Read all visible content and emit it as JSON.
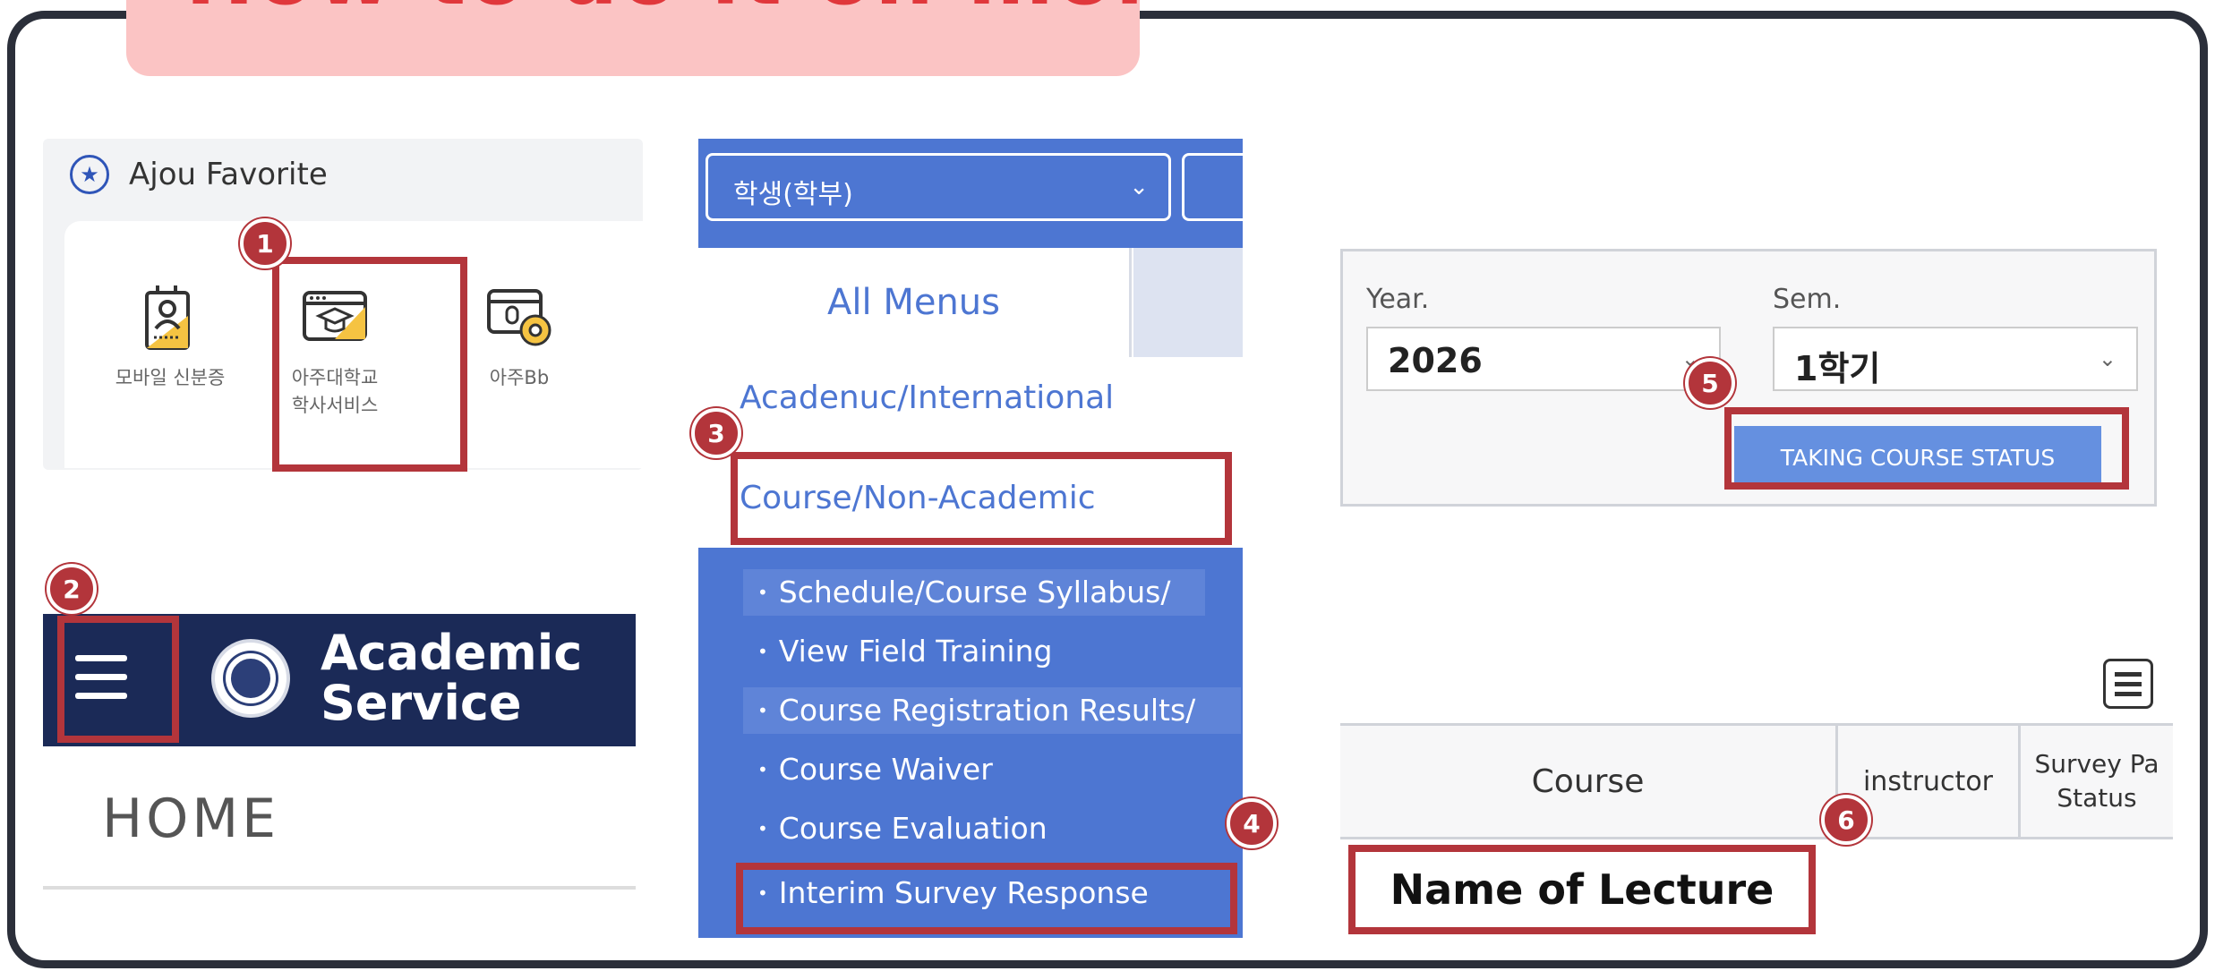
{
  "page": {
    "title": "How to do it on mobile"
  },
  "favorites": {
    "title": "Ajou Favorite",
    "items": [
      {
        "label_l1": "모바일 신분증",
        "label_l2": "",
        "icon": "id-badge-icon"
      },
      {
        "label_l1": "아주대학교",
        "label_l2": "학사서비스",
        "icon": "graduation-cap-window-icon"
      },
      {
        "label_l1": "아주Bb",
        "label_l2": "",
        "icon": "mic-settings-icon"
      }
    ]
  },
  "academic_service": {
    "title_l1": "Academic",
    "title_l2": "Service",
    "home": "HOME"
  },
  "menu": {
    "select_value": "학생(학부)",
    "all_menus": "All Menus",
    "items": [
      "Acadenuc/International",
      "Course/Non-Academic"
    ],
    "sub_items": [
      "Schedule/Course Syllabus/",
      "View Field Training",
      "Course Registration Results/",
      "Course Waiver",
      "Course Evaluation",
      "Interim Survey Response"
    ]
  },
  "filters": {
    "year_label": "Year.",
    "year_value": "2026",
    "sem_label": "Sem.",
    "sem_value": "1학기",
    "button": "TAKING COURSE STATUS"
  },
  "table": {
    "headers": [
      "Course",
      "instructor",
      "Survey Pa",
      "Status"
    ],
    "row_value": "Name of Lecture"
  },
  "steps": [
    "1",
    "2",
    "3",
    "4",
    "5",
    "6"
  ],
  "colors": {
    "accent_red": "#b3353b",
    "menu_blue": "#4d76d2",
    "header_navy": "#1b2a57",
    "title_pink": "#fbc4c4"
  }
}
